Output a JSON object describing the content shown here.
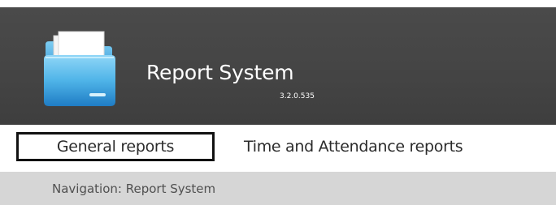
{
  "header": {
    "app_title": "Report System",
    "version": "3.2.0.535",
    "logo_icon": "folder-icon"
  },
  "tabs": [
    {
      "label": "General reports",
      "selected": true
    },
    {
      "label": "Time and Attendance reports",
      "selected": false
    }
  ],
  "navigation": {
    "text": "Navigation: Report System"
  },
  "colors": {
    "header_background": "#444444",
    "navigation_background": "#d6d6d6",
    "selected_tab_border": "#111111"
  }
}
